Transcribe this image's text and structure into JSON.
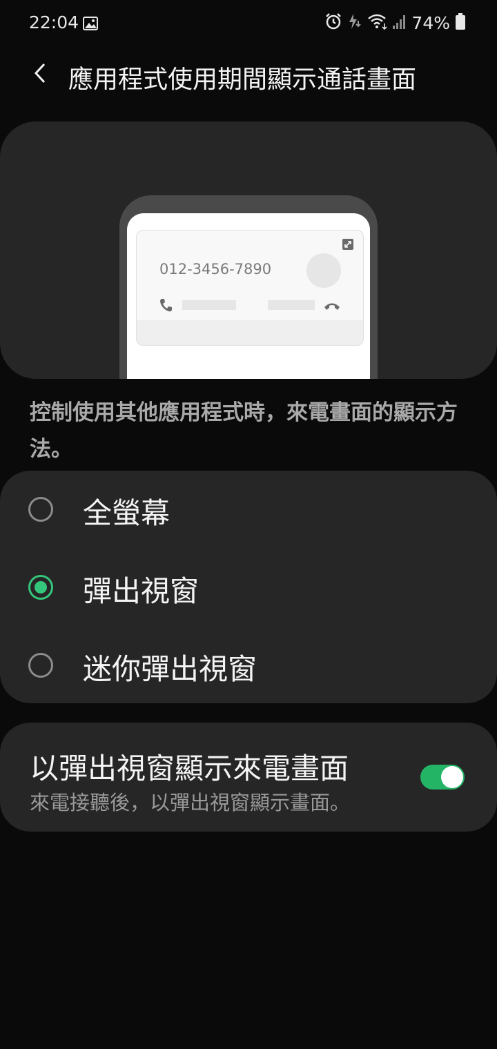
{
  "status_bar": {
    "time": "22:04",
    "battery": "74%",
    "icons": [
      "gallery-icon",
      "alarm-icon",
      "charging-icon",
      "wifi-icon",
      "signal-icon",
      "battery-icon"
    ]
  },
  "header": {
    "title": "應用程式使用期間顯示通話畫面",
    "back_icon": "chevron-left-icon"
  },
  "preview": {
    "phone_number": "012-3456-7890",
    "icons": [
      "expand-icon",
      "phone-icon",
      "end-call-icon"
    ]
  },
  "description": "控制使用其他應用程式時，來電畫面的顯示方法。",
  "options": [
    {
      "label": "全螢幕",
      "selected": false
    },
    {
      "label": "彈出視窗",
      "selected": true
    },
    {
      "label": "迷你彈出視窗",
      "selected": false
    }
  ],
  "popup_toggle": {
    "title": "以彈出視窗顯示來電畫面",
    "subtitle": "來電接聽後，以彈出視窗顯示畫面。",
    "enabled": true
  },
  "colors": {
    "accent": "#34c77b",
    "switch_on": "#24b466",
    "card": "#262626",
    "background": "#0a0a0a"
  }
}
